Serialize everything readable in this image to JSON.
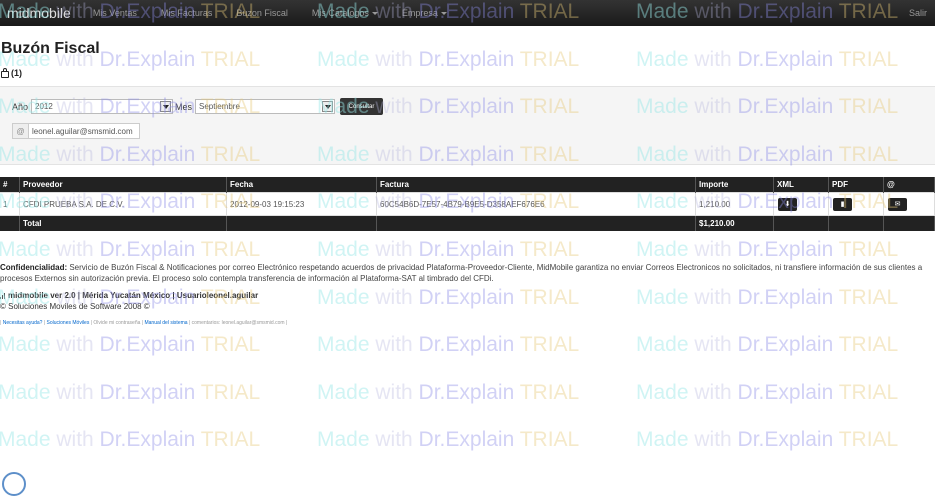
{
  "navbar": {
    "brand": "midmobile",
    "items": [
      {
        "label": "Mis Ventas"
      },
      {
        "label": "Mis Facturas"
      },
      {
        "label": "Buzon Fiscal"
      },
      {
        "label": "Mis Catalogos"
      },
      {
        "label": "Empresa"
      }
    ],
    "right": "Salir"
  },
  "page": {
    "title": "Buzón Fiscal",
    "count": "(1)"
  },
  "filter": {
    "year_label": "Año",
    "year_value": "2012",
    "month_label": "Mes",
    "month_value": "Septiembre",
    "submit_label": "Consultar",
    "email_addon": "@",
    "email_value": "leonel.aguilar@smsmid.com"
  },
  "table": {
    "headers": [
      "#",
      "Proveedor",
      "Fecha",
      "Factura",
      "Importe",
      "XML",
      "PDF",
      "@"
    ],
    "rows": [
      {
        "num": "1",
        "proveedor": "CFDI PRUEBA S.A. DE C.V.",
        "fecha": "2012-09-03 19:15:23",
        "factura": "60C54B6D-7E57-4B79-B9E5-D358AEF676E6",
        "importe": "1,210.00"
      }
    ],
    "total_label": "Total",
    "total_value": "$1,210.00"
  },
  "footer": {
    "conf_label": "Confidencialidad:",
    "conf_text": " Servicio de Buzón Fiscal & Notificaciones por correo Electrónico respetando acuerdos de privacidad Plataforma-Proveedor-Cliente, MidMobile garantiza no enviar Correos Electronicos no solicitados, ni transfiere información de sus clientes a procesos Externos sin autorización previa. El proceso solo contempla transferencia de información al Plataforma-SAT al timbrado del CFDi.",
    "version": "midmobile ver 2.0 | Mérida Yucatán México | Usuarioleonel.aguilar",
    "copyright": "© Soluciones Moviles de Software 2008 ©",
    "link_help": "Necesitas ayuda?",
    "link_mobile": "Soluciones Móviles",
    "link_forgot": "Olvide mi contraseña",
    "link_manual": "Manual del sistema",
    "comments": "comentarios: leonel.aguilar@smsmid.com"
  },
  "watermark": {
    "made": "Made",
    "with": " with ",
    "dr": "Dr.Explain",
    "trial": " TRIAL"
  }
}
